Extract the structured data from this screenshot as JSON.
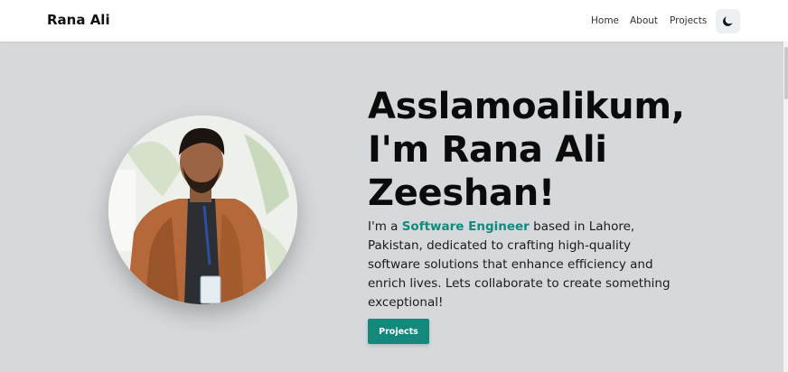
{
  "header": {
    "brand": "Rana Ali",
    "nav": [
      {
        "label": "Home"
      },
      {
        "label": "About"
      },
      {
        "label": "Projects"
      }
    ],
    "theme_toggle_icon": "moon-icon"
  },
  "hero": {
    "title_line1": "Asslamoalikum,",
    "title_line2": "I'm Rana Ali",
    "title_line3": "Zeeshan!",
    "desc_prefix": "I'm a ",
    "desc_highlight": "Software Engineer",
    "desc_suffix": " based in Lahore, Pakistan, dedicated to crafting high-quality software solutions that enhance efficiency and enrich lives. Lets collaborate to create something exceptional!",
    "cta_label": "Projects",
    "profile_image": "profile-photo"
  },
  "colors": {
    "accent": "#12897c",
    "background": "#d6d9db",
    "nav_background": "#ffffff"
  }
}
